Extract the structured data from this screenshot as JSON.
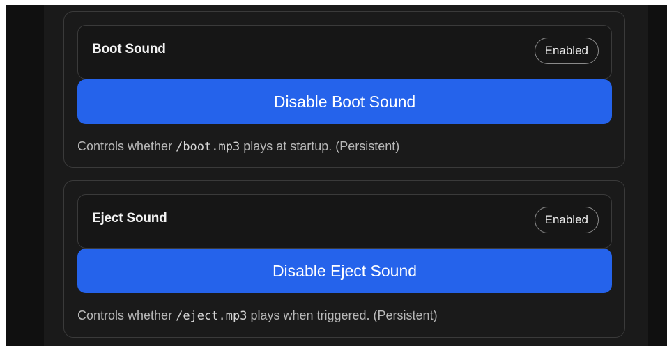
{
  "colors": {
    "background": "#1a1a1a",
    "card_border": "#3a3a3a",
    "primary_button": "#2563eb",
    "text_primary": "#f2f2f2",
    "text_secondary": "#b8b8b8"
  },
  "settings": [
    {
      "title": "Boot Sound",
      "status": "Enabled",
      "button_label": "Disable Boot Sound",
      "description_prefix": "Controls whether ",
      "description_code": "/boot.mp3",
      "description_suffix": " plays at startup. (Persistent)"
    },
    {
      "title": "Eject Sound",
      "status": "Enabled",
      "button_label": "Disable Eject Sound",
      "description_prefix": "Controls whether ",
      "description_code": "/eject.mp3",
      "description_suffix": " plays when triggered. (Persistent)"
    }
  ]
}
